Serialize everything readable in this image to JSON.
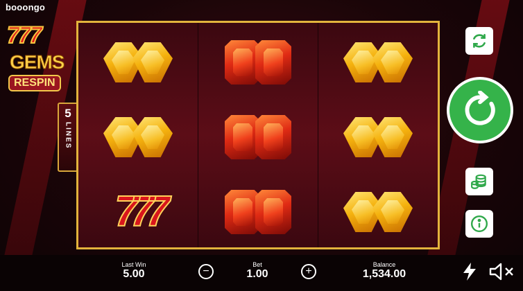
{
  "brand": "booongo",
  "logo": {
    "line1": "777",
    "line2": "GEMS",
    "line3": "RESPIN"
  },
  "lines_badge": {
    "number": "5",
    "word": "LINES"
  },
  "reels": [
    [
      "gem-yellow",
      "gem-yellow",
      "seven"
    ],
    [
      "gem-red",
      "gem-red",
      "gem-red"
    ],
    [
      "gem-yellow",
      "gem-yellow",
      "gem-yellow"
    ]
  ],
  "symbols": {
    "seven_text": "777"
  },
  "bottom_bar": {
    "last_win_label": "Last Win",
    "last_win_value": "5.00",
    "bet_label": "Bet",
    "bet_value": "1.00",
    "balance_label": "Balance",
    "balance_value": "1,534.00",
    "decrease_glyph": "−",
    "increase_glyph": "+"
  },
  "buttons": {
    "autoplay_icon": "refresh-icon",
    "spin_icon": "spin-arrow-icon",
    "bet_icon": "coins-icon",
    "info_icon": "info-icon",
    "turbo_icon": "lightning-icon",
    "sound_icon": "speaker-muted-icon"
  },
  "colors": {
    "frame": "#e3b43c",
    "spin": "#35b34a",
    "background": "#1a0508"
  }
}
